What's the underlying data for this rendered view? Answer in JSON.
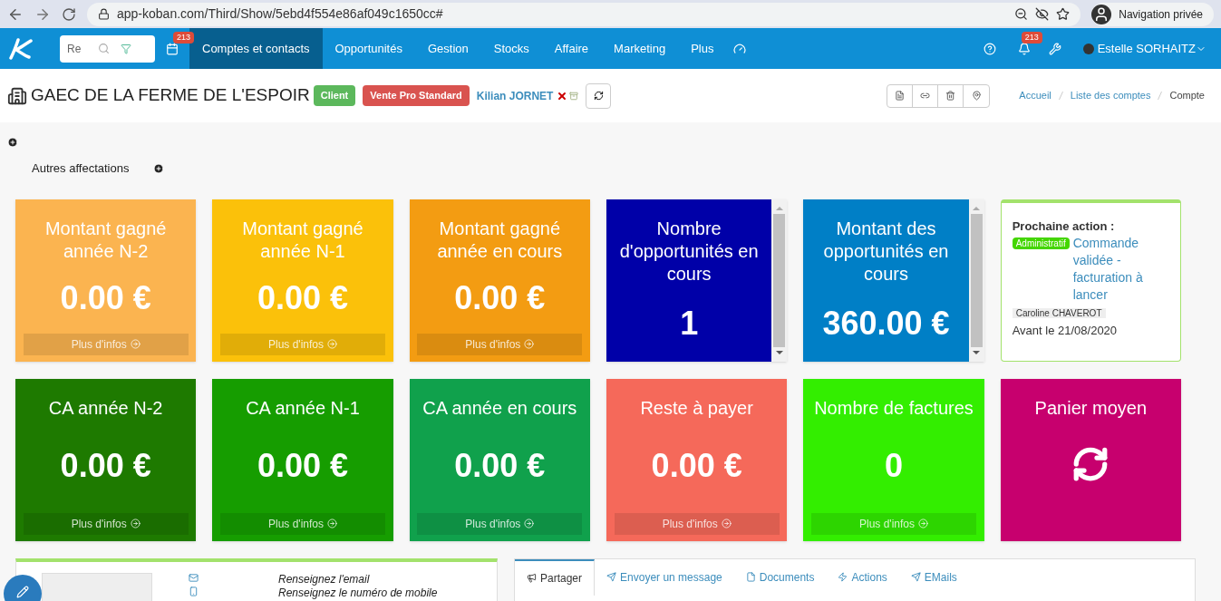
{
  "browser": {
    "url": "app-koban.com/Third/Show/5ebd4f554e86af049c1650cc#",
    "profile": "Navigation privée"
  },
  "navbar": {
    "search_placeholder": "Re",
    "calendar_badge": "213",
    "bell_badge": "213",
    "user": "Estelle SORHAITZ",
    "items": [
      {
        "label": "Comptes et contacts",
        "selected": true
      },
      {
        "label": "Opportunités",
        "selected": false
      },
      {
        "label": "Gestion",
        "selected": false
      },
      {
        "label": "Stocks",
        "selected": false
      },
      {
        "label": "Affaire",
        "selected": false
      },
      {
        "label": "Marketing",
        "selected": false
      },
      {
        "label": "Plus",
        "selected": false
      }
    ]
  },
  "header": {
    "title": "GAEC DE LA FERME DE L'ESPOIR",
    "tags": [
      {
        "label": "Client",
        "color": "#5cb85c"
      },
      {
        "label": "Vente Pro Standard",
        "color": "#d9534f"
      }
    ],
    "owner": "Kilian JORNET",
    "breadcrumb": [
      {
        "label": "Accueil",
        "selected": false
      },
      {
        "label": "Liste des comptes",
        "selected": false
      },
      {
        "label": "Compte",
        "selected": true
      }
    ]
  },
  "affectations": {
    "label": "Autres affectations"
  },
  "tiles": [
    {
      "kind": "amount",
      "color": "#fbb450",
      "title": "Montant gagné année N-2",
      "value": "0.00 €",
      "more": "Plus d'infos"
    },
    {
      "kind": "amount",
      "color": "#fbc10a",
      "title": "Montant gagné année N-1",
      "value": "0.00 €",
      "more": "Plus d'infos"
    },
    {
      "kind": "amount",
      "color": "#f39c12",
      "title": "Montant gagné année en cours",
      "value": "0.00 €",
      "more": "Plus d'infos"
    },
    {
      "kind": "scroll",
      "color": "#0000a8",
      "title": "Nombre d'opportunités en cours",
      "value": "1"
    },
    {
      "kind": "scroll",
      "color": "#007fc6",
      "title": "Montant des opportunités en cours",
      "value": "360.00 €"
    },
    {
      "kind": "action",
      "heading": "Prochaine action :",
      "category": "Administratif",
      "link": "Commande validée - facturation à lancer",
      "assignee": "Caroline CHAVEROT",
      "due": "Avant le 21/08/2020"
    },
    {
      "kind": "amount",
      "color": "#1e7a00",
      "title": "CA année N-2",
      "value": "0.00 €",
      "more": "Plus d'infos"
    },
    {
      "kind": "amount",
      "color": "#169d00",
      "title": "CA année N-1",
      "value": "0.00 €",
      "more": "Plus d'infos"
    },
    {
      "kind": "amount",
      "color": "#10a14c",
      "title": "CA année en cours",
      "value": "0.00 €",
      "more": "Plus d'infos"
    },
    {
      "kind": "amount",
      "color": "#f5695a",
      "title": "Reste à payer",
      "value": "0.00 €",
      "more": "Plus d'infos"
    },
    {
      "kind": "amount",
      "color": "#33ee00",
      "title": "Nombre de factures",
      "value": "0",
      "more": "Plus d'infos"
    },
    {
      "kind": "loading",
      "color": "#c7006e",
      "title": "Panier moyen"
    }
  ],
  "contact": {
    "email": "Renseignez l'email",
    "mobile": "Renseignez le numéro de mobile"
  },
  "tabs": [
    {
      "label": "Partager",
      "selected": true
    },
    {
      "label": "Envoyer un message",
      "selected": false
    },
    {
      "label": "Documents",
      "selected": false
    },
    {
      "label": "Actions",
      "selected": false
    },
    {
      "label": "EMails",
      "selected": false
    }
  ]
}
